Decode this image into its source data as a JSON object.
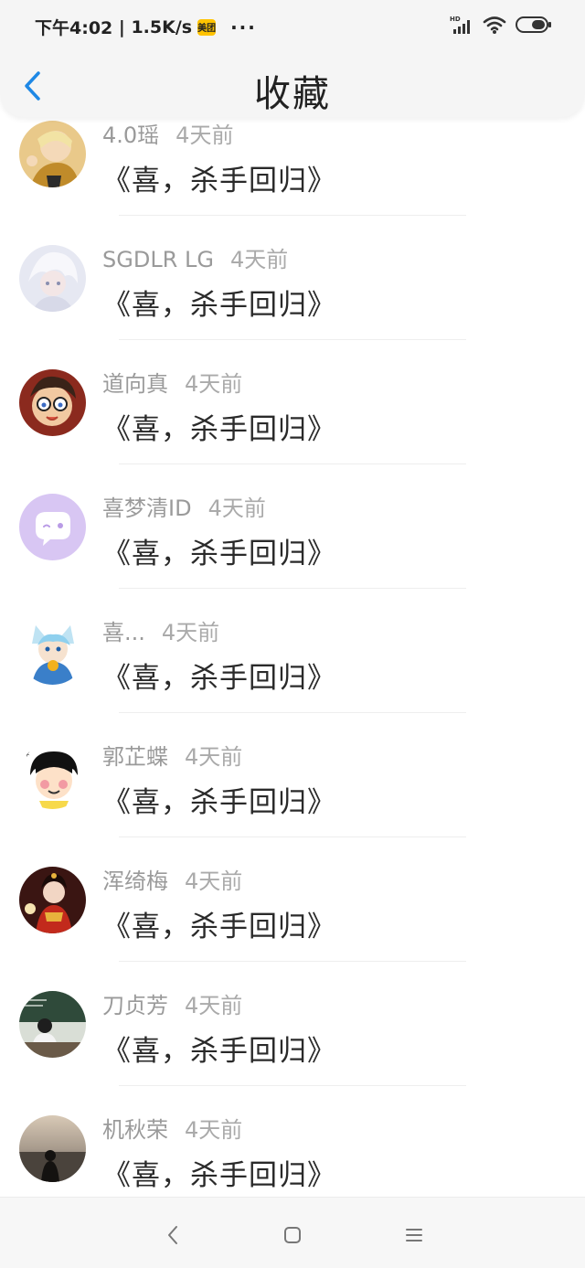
{
  "status_bar": {
    "time": "下午4:02",
    "speed": "1.5K/s",
    "app_badge": "美团",
    "more": "···",
    "network_label": "HD"
  },
  "header": {
    "title": "收藏",
    "back_icon": "chevron-left-icon"
  },
  "colors": {
    "accent": "#1e88e5",
    "meituan": "#ffc300"
  },
  "items": [
    {
      "name": "4.0瑶",
      "time": "4天前",
      "message": "《喜，杀手回归》",
      "avatar": "anime-character-avatar"
    },
    {
      "name": "SGDLR LG",
      "time": "4天前",
      "message": "《喜，杀手回归》",
      "avatar": "white-hair-anime-avatar"
    },
    {
      "name": "道向真",
      "time": "4天前",
      "message": "《喜，杀手回归》",
      "avatar": "glasses-boy-avatar"
    },
    {
      "name": "喜梦清ID",
      "time": "4天前",
      "message": "《喜，杀手回归》",
      "avatar": "default-chat-avatar"
    },
    {
      "name": "喜...",
      "time": "4天前",
      "message": "《喜，杀手回归》",
      "avatar": "blue-cat-anime-avatar"
    },
    {
      "name": "郭芷蝶",
      "time": "4天前",
      "message": "《喜，杀手回归》",
      "avatar": "cartoon-face-avatar"
    },
    {
      "name": "浑绮梅",
      "time": "4天前",
      "message": "《喜，杀手回归》",
      "avatar": "costume-girl-avatar"
    },
    {
      "name": "刀贞芳",
      "time": "4天前",
      "message": "《喜，杀手回归》",
      "avatar": "classroom-avatar"
    },
    {
      "name": "机秋荣",
      "time": "4天前",
      "message": "《喜，杀手回归》",
      "avatar": "sunset-silhouette-avatar"
    }
  ],
  "nav": {
    "back": "nav-back-icon",
    "home": "nav-home-icon",
    "menu": "nav-menu-icon"
  }
}
